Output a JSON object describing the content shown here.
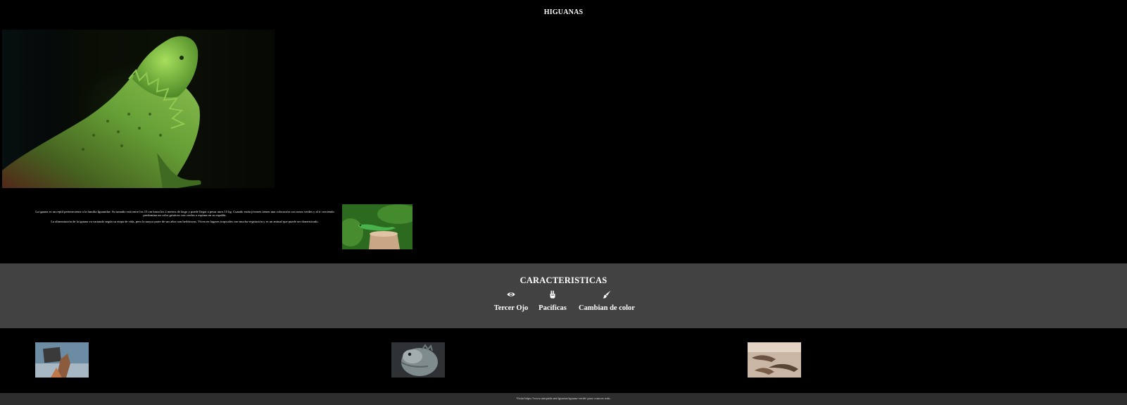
{
  "header": {
    "title": "HIGUANAS"
  },
  "hero": {
    "image": "green-iguana-on-dark-background"
  },
  "intro": {
    "paragraph_1": "La iguana es un reptil perteneciente a la familia Iguanidae. Su tamaño está entre los 15 cm hasta los 2 metros de largo y puede llegar a pesar unos 15 kg. Cuando están jóvenes tienen una coloración con tonos verdes y al ir creciendo predomina un color grisáceo con cerdos o espinas en su espalda.",
    "paragraph_2": "La alimentación de la iguana va variando según su etapa de vida, pero la mayor parte de sus años son herbívoras. Viven en lugares tropicales con mucha vegetación y es un animal que puede ser domesticado.",
    "side_image": "green-lizard-on-tree-stump"
  },
  "features": {
    "title": "CARACTERISTICAS",
    "items": [
      {
        "icon": "eye-icon",
        "label": "Tercer Ojo"
      },
      {
        "icon": "peace-hand-icon",
        "label": "Pacificas"
      },
      {
        "icon": "paintbrush-icon",
        "label": "Cambian de color"
      }
    ]
  },
  "gallery": [
    {
      "image": "iguana-with-sign-photo"
    },
    {
      "image": "iguana-head-closeup-photo"
    },
    {
      "image": "iguanas-group-photo"
    }
  ],
  "footer": {
    "text": "Visita https://www.aniquida.net/iguanas/iguana-verde/ para conocer más."
  },
  "colors": {
    "background": "#000000",
    "features_band": "#424242",
    "footer_band": "#2e2e2e",
    "text": "#ffffff"
  }
}
